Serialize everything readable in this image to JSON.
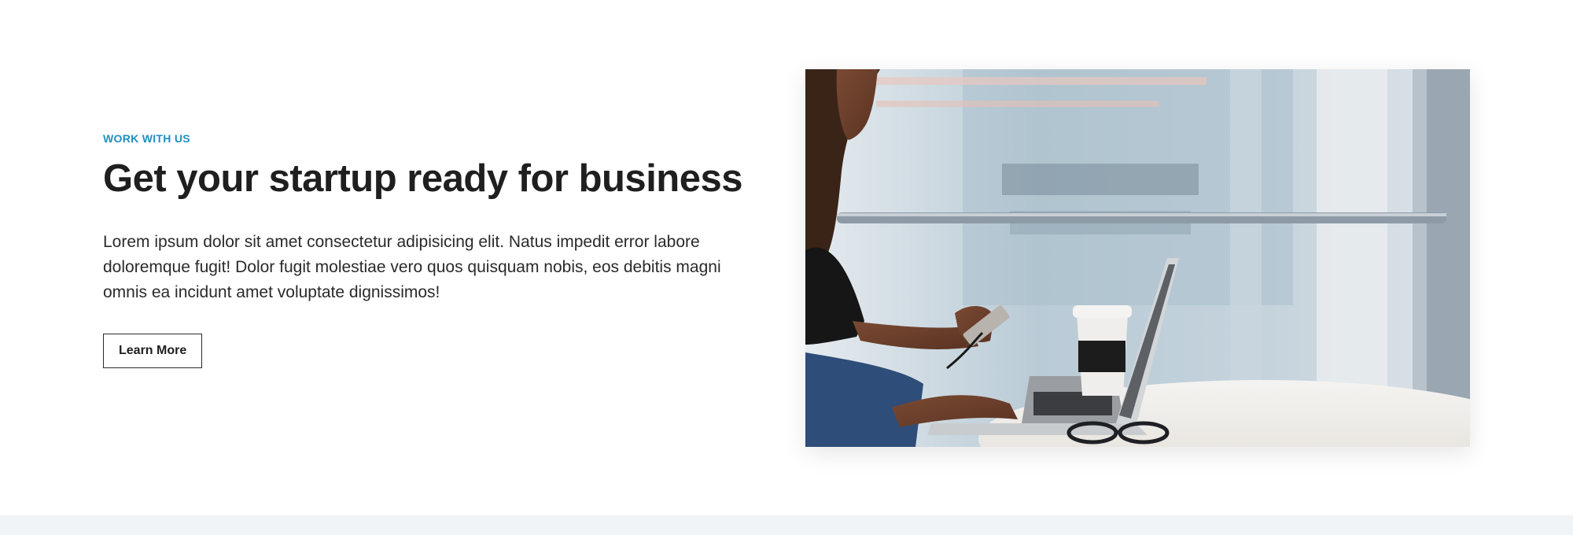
{
  "section": {
    "eyebrow": "WORK WITH US",
    "headline": "Get your startup ready for business",
    "body": "Lorem ipsum dolor sit amet consectetur adipisicing elit. Natus impedit error labore doloremque fugit! Dolor fugit molestiae vero quos quisquam nobis, eos debitis magni omnis ea incidunt amet voluptate dignissimos!",
    "cta_label": "Learn More"
  },
  "colors": {
    "accent": "#1f8fc0",
    "text": "#222222",
    "band": "#f0f4f7"
  },
  "photo": {
    "icon": "photo-woman-laptop"
  }
}
